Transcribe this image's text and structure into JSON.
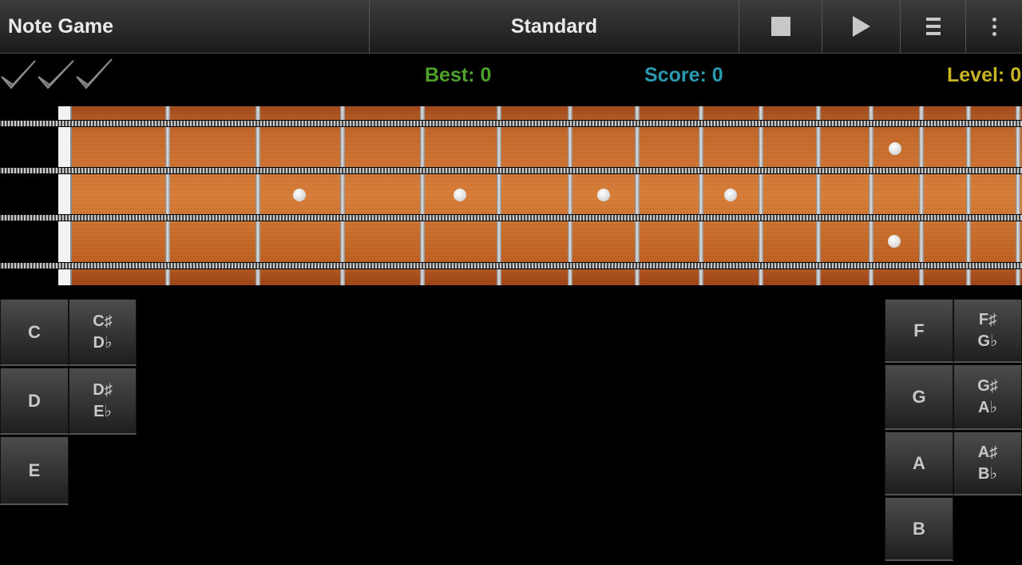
{
  "header": {
    "title": "Note Game",
    "tuning": "Standard",
    "buttons": [
      "stop-icon",
      "play-icon",
      "menu-icon",
      "overflow-icon"
    ]
  },
  "status": {
    "best": "Best: 0",
    "score": "Score: 0",
    "level": "Level: 0"
  },
  "colors": {
    "best": "#4ea12a",
    "score": "#2a9ab0",
    "level": "#c8b322"
  },
  "lives_icons": [
    "check-icon",
    "check-icon",
    "check-icon"
  ],
  "fretboard": {
    "strings": 4,
    "inlay_markers": [
      "fret-3",
      "fret-5",
      "fret-7",
      "fret-9",
      "fret-12-double"
    ]
  },
  "notes_left": {
    "c": "C",
    "c_sharp": "C♯",
    "d_flat": "D♭",
    "d": "D",
    "d_sharp": "D♯",
    "e_flat": "E♭",
    "e": "E"
  },
  "notes_right": {
    "f": "F",
    "f_sharp": "F♯",
    "g_flat": "G♭",
    "g": "G",
    "g_sharp": "G♯",
    "a_flat": "A♭",
    "a": "A",
    "a_sharp": "A♯",
    "b_flat": "B♭",
    "b": "B"
  }
}
